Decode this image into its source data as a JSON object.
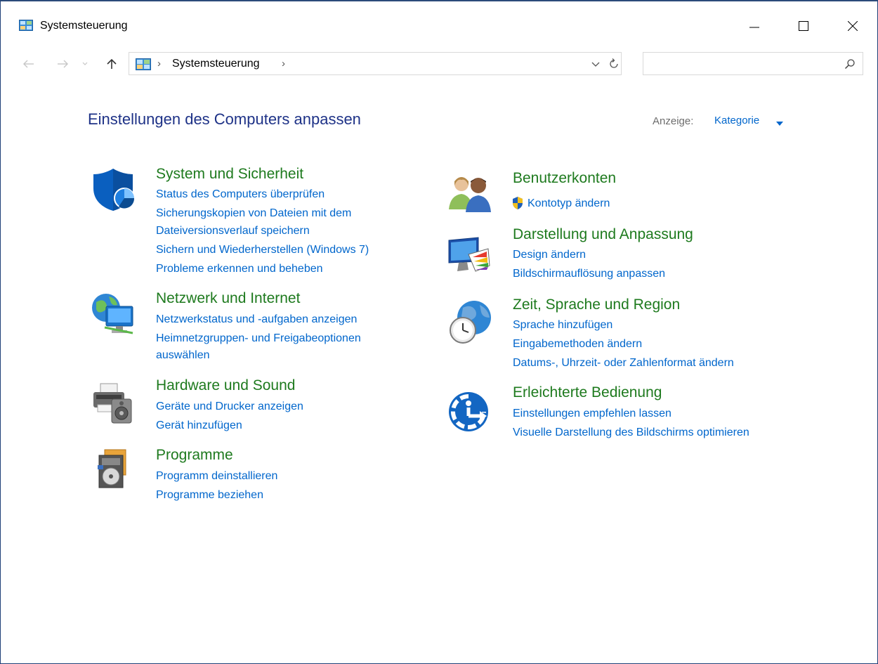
{
  "window": {
    "title": "Systemsteuerung"
  },
  "address": {
    "path": "Systemsteuerung",
    "separator": "›",
    "search_placeholder": ""
  },
  "header": {
    "page_title": "Einstellungen des Computers anpassen",
    "view_label": "Anzeige:",
    "view_value": "Kategorie"
  },
  "categories": {
    "system": {
      "title": "System und Sicherheit",
      "links": [
        "Status des Computers überprüfen",
        "Sicherungskopien von Dateien mit dem",
        "Dateiversionsverlauf speichern",
        "Sichern und Wiederherstellen (Windows 7)",
        "Probleme erkennen und beheben"
      ]
    },
    "network": {
      "title": "Netzwerk und Internet",
      "links": [
        "Netzwerkstatus und -aufgaben anzeigen",
        "Heimnetzgruppen- und Freigabeoptionen",
        "auswählen"
      ]
    },
    "hardware": {
      "title": "Hardware und Sound",
      "links": [
        "Geräte und Drucker anzeigen",
        "Gerät hinzufügen"
      ]
    },
    "programs": {
      "title": "Programme",
      "links": [
        "Programm deinstallieren",
        "Programme beziehen"
      ]
    },
    "users": {
      "title": "Benutzerkonten",
      "links": [
        "Kontotyp ändern"
      ]
    },
    "appearance": {
      "title": "Darstellung und Anpassung",
      "links": [
        "Design ändern",
        "Bildschirmauflösung anpassen"
      ]
    },
    "clock": {
      "title": "Zeit, Sprache und Region",
      "links": [
        "Sprache hinzufügen",
        "Eingabemethoden ändern",
        "Datums-, Uhrzeit- oder Zahlenformat ändern"
      ]
    },
    "ease": {
      "title": "Erleichterte Bedienung",
      "links": [
        "Einstellungen empfehlen lassen",
        "Visuelle Darstellung des Bildschirms optimieren"
      ]
    }
  },
  "colors": {
    "title_blue": "#1e3287",
    "category_green": "#1e7a1e",
    "link_blue": "#0066cc",
    "window_border": "#1e3f78"
  },
  "icons": {
    "window": "control-panel-icon",
    "system": "shield-icon",
    "network": "network-globe-icon",
    "hardware": "printer-speaker-icon",
    "programs": "programs-disc-icon",
    "users": "users-icon",
    "appearance": "monitor-palette-icon",
    "clock": "globe-clock-icon",
    "ease": "ease-of-access-icon",
    "uac": "uac-shield-icon"
  }
}
